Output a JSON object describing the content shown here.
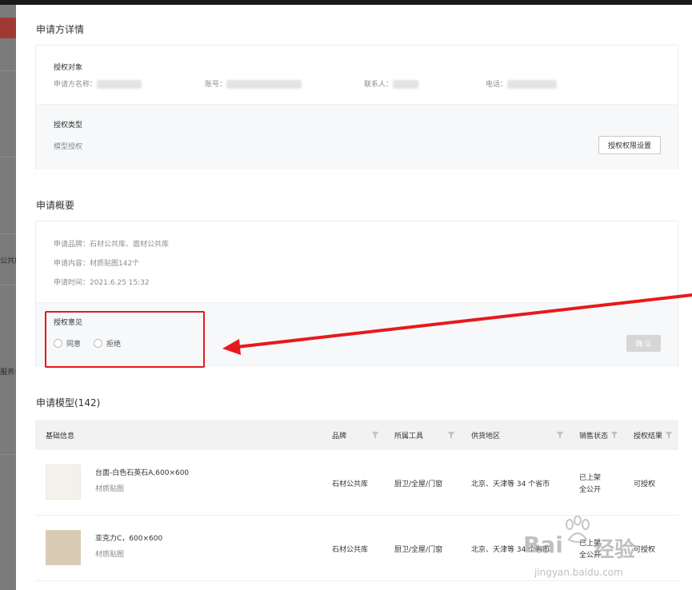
{
  "background": {
    "frag_mid": "公共库",
    "frag_low": "服务公"
  },
  "applicant": {
    "title": "申请方详情",
    "target": {
      "label": "授权对象",
      "name_label": "申请方名称：",
      "account_label": "账号：",
      "contact_label": "联系人：",
      "phone_label": "电话："
    },
    "type": {
      "label": "授权类型",
      "value": "模型授权",
      "settings_button": "授权权限设置"
    }
  },
  "overview": {
    "title": "申请概要",
    "brand": "申请品牌：石材公共库、面材公共库",
    "content": "申请内容：材质贴图142个",
    "time": "申请时间：2021.6.25 15:32",
    "opinion": {
      "label": "授权意见",
      "agree": "同意",
      "reject": "拒绝",
      "confirm_button": "确 认"
    }
  },
  "models": {
    "title": "申请模型(142)",
    "columns": [
      "基础信息",
      "品牌",
      "所属工具",
      "供货地区",
      "销售状态",
      "授权结果"
    ],
    "rows": [
      {
        "name": "台面-白色石英石A,600×600",
        "category": "材质贴图",
        "brand": "石材公共库",
        "tool": "厨卫/全屋/门窗",
        "region": "北京、天津等 34 个省市",
        "status_line1": "已上架",
        "status_line2": "全公开",
        "result": "可授权",
        "thumb_color": "#f4f1ea"
      },
      {
        "name": "亚克力C，600×600",
        "category": "材质贴图",
        "brand": "石材公共库",
        "tool": "厨卫/全屋/门窗",
        "region": "北京、天津等 34 个省市",
        "status_line1": "已上架",
        "status_line2": "全公开",
        "result": "可授权",
        "thumb_color": "#d9ccb4"
      }
    ]
  },
  "watermark": {
    "brand": "Bai",
    "brand_cn": "经验",
    "url": "jingyan.baidu.com"
  },
  "colors": {
    "highlight": "#e8191b",
    "band": "#f6f8fa",
    "table_header": "#f2f2f2"
  }
}
